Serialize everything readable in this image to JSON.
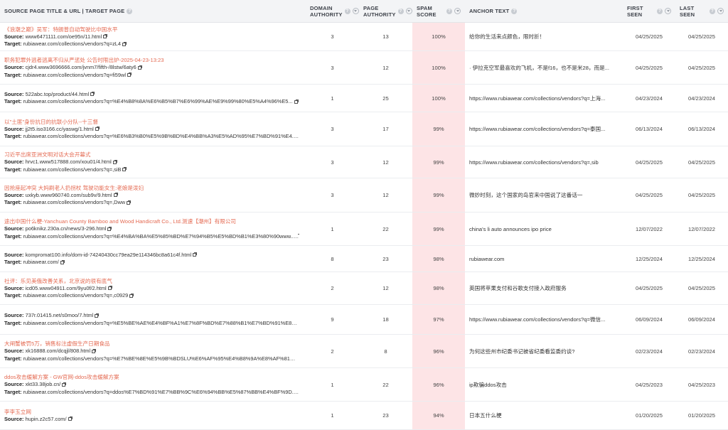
{
  "headers": {
    "source": "SOURCE PAGE TITLE & URL | TARGET PAGE",
    "domain_authority": "DOMAIN AUTHORITY",
    "page_authority": "PAGE AUTHORITY",
    "spam_score": "SPAM SCORE",
    "anchor_text": "ANCHOR TEXT",
    "first_seen": "FIRST SEEN",
    "last_seen": "LAST SEEN"
  },
  "labels": {
    "source": "Source:",
    "target": "Target:"
  },
  "rows": [
    {
      "title": "《浪潮之巅》吴军：特朗普自动驾驶比中国水平",
      "source": "www6471111.com/oe95n/11.html",
      "target": "rubiawear.com/collections/vendors?q=zL4",
      "da": "3",
      "pa": "13",
      "spam": "100%",
      "anchor": "给你的生活来点颜色，限时折！",
      "first_seen": "04/25/2025",
      "last_seen": "04/25/2025"
    },
    {
      "title": "职务犯罪外逃者逃离不归从严惩处 公告时限出炉-2025-04-23-13:23",
      "source": "cjdr4.www3696666.com/jvnm7/fifth-/8lstw/6aty6",
      "target": "rubiawear.com/collections/vendors?q=fi59wl",
      "da": "3",
      "pa": "12",
      "spam": "100%",
      "anchor": "· 伊拉克空军最喜欢的飞机，不是f16，也不是米28，而是...",
      "first_seen": "04/25/2025",
      "last_seen": "04/25/2025"
    },
    {
      "title": "",
      "source": "522abc.top/product/44.html",
      "target": "rubiawear.com/collections/vendors?q=%E4%B8%8A%E6%B5%B7%E6%99%AE%E9%99%80%E5%A4%96%E5...",
      "da": "1",
      "pa": "25",
      "spam": "100%",
      "anchor": "https://www.rubiawear.com/collections/vendors?q=上海...",
      "first_seen": "04/23/2024",
      "last_seen": "04/23/2024"
    },
    {
      "title": "以\"土匪\"身份抗日的抗联小分队--十三督",
      "source": "jj2t5.iso3166.cc/yaswg/1.html",
      "target": "rubiawear.com/collections/vendors?q=%E6%B3%B0%E5%9B%BD%E4%BB%A3%E5%AD%95%E7%BD%91%E4...",
      "da": "3",
      "pa": "17",
      "spam": "99%",
      "anchor": "https://www.rubiawear.com/collections/vendors?q=泰国...",
      "first_seen": "06/13/2024",
      "last_seen": "06/13/2024"
    },
    {
      "title": "习近平出席亚洲文明对话大会开幕式",
      "source": "hrvc1.www517888.com/xou01/4.html",
      "target": "rubiawear.com/collections/vendors?q=,siB",
      "da": "3",
      "pa": "12",
      "spam": "99%",
      "anchor": "https://www.rubiawear.com/collections/vendors?q=,sib",
      "first_seen": "04/25/2025",
      "last_seen": "04/25/2025"
    },
    {
      "title": "因抢座起冲突 大妈刷老人扔拐杖 驾驶功能女生:老娘是泼妇",
      "source": "uxkyb.www960740.com/sub9v/9.html",
      "target": "rubiawear.com/collections/vendors?q=,Dww",
      "da": "3",
      "pa": "12",
      "spam": "99%",
      "anchor": "微妙时刻，这个国家的岛官来中国说了这番话一",
      "first_seen": "04/25/2025",
      "last_seen": "04/25/2025"
    },
    {
      "title": "途出中国什么梗-Yanchuan County Bamboo and Wood Handicraft Co., Ltd.测速【潮州】有限公司",
      "source": "po6knikz.230a.cn/news/3-296.html",
      "target": "rubiawear.com/collections/vendors?q=%E4%BA%BA%E5%85%BD%E7%94%B5%E5%BD%B1%E3%80%90www...",
      "da": "1",
      "pa": "22",
      "spam": "99%",
      "anchor": "china's li auto announces ipo price",
      "first_seen": "12/07/2022",
      "last_seen": "12/07/2022"
    },
    {
      "title": "",
      "source": "kompromat100.info/dom-id-74240430cc79ea29e114346bc8a61c4f.html",
      "target": "rubiawear.com/",
      "da": "8",
      "pa": "23",
      "spam": "98%",
      "anchor": "rubiawear.com",
      "first_seen": "12/25/2024",
      "last_seen": "12/25/2024"
    },
    {
      "title": "社评：乐见美俄改善关系，北京说的很有底气",
      "source": "icd05.www04911.com/9yu0f/2.html",
      "target": "rubiawear.com/collections/vendors?q=,c0929",
      "da": "2",
      "pa": "12",
      "spam": "98%",
      "anchor": "英国将苹果支付和谷歌支付接入政府服务",
      "first_seen": "04/25/2025",
      "last_seen": "04/25/2025"
    },
    {
      "title": "",
      "source": "737r.01415.net/s0moo/7.html",
      "target": "rubiawear.com/collections/vendors?q=%E5%BE%AE%E4%BF%A1%E7%8F%BD%E7%88%B1%E7%BD%91%E8%B...",
      "da": "9",
      "pa": "18",
      "spam": "97%",
      "anchor": "https://www.rubiawear.com/collections/vendors?q=微信...",
      "first_seen": "06/09/2024",
      "last_seen": "06/09/2024"
    },
    {
      "title": "大闸蟹被罚5万，销售标注虚假生产日期食品",
      "source": "xk16888.com/dcqjl/808.html",
      "target": "rubiawear.com/collections/vendors?q=%E7%BE%8E%E5%9B%BDSLU%E6%AF%95%E4%B8%9A%E8%AF%81%...",
      "da": "2",
      "pa": "8",
      "spam": "96%",
      "anchor": "为何这些州市纪委书记被省纪委看监委约谈?",
      "first_seen": "02/23/2024",
      "last_seen": "02/23/2024"
    },
    {
      "title": "ddos攻击缓解方案 - GW官网-ddos攻击缓解方案",
      "source": "xkt33.38job.cn/",
      "target": "rubiawear.com/collections/vendors?q=ddos%E7%BD%91%E7%BB%9C%E6%94%BB%E5%87%BB%E4%BF%9D...",
      "da": "1",
      "pa": "22",
      "spam": "96%",
      "anchor": "ip欺骗ddos攻击",
      "first_seen": "04/25/2023",
      "last_seen": "04/25/2023"
    },
    {
      "title": "李李玉立网",
      "source": "hupin.z2c57.com/",
      "target": "",
      "da": "1",
      "pa": "23",
      "spam": "94%",
      "anchor": "日本五什么梗",
      "first_seen": "01/20/2025",
      "last_seen": "01/20/2025"
    }
  ]
}
